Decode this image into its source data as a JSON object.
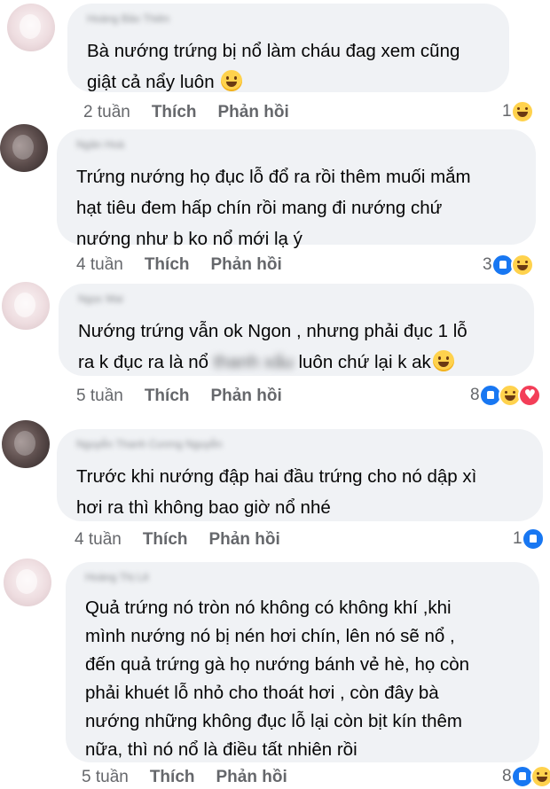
{
  "comments": [
    {
      "author": "Hoàng Bảo Thiên",
      "lines": [
        "Bà nướng trứng bị nổ làm cháu đag xem cũng",
        "giật cả nẩy luôn"
      ],
      "time": "2 tuần",
      "like": "Thích",
      "reply": "Phản hồi",
      "reaction_count": "1",
      "reactions": [
        "haha"
      ]
    },
    {
      "author": "Ngân Hoà",
      "lines": [
        "Trứng nướng họ đục lỗ đổ ra rồi thêm muối mắm",
        "hạt tiêu đem hấp chín rồi mang đi nướng chứ",
        "nướng như b ko nổ mới lạ ý"
      ],
      "time": "4 tuần",
      "like": "Thích",
      "reply": "Phản hồi",
      "reaction_count": "3",
      "reactions": [
        "like",
        "haha"
      ]
    },
    {
      "author": "Ngọc Mai",
      "line1": "Nướng trứng vẫn ok Ngon , nhưng phải đục 1 lỗ",
      "line2_a": "ra k đục ra là nổ",
      "line2_hidden": "thanh xấu",
      "line2_b": "luôn chứ lại k ak",
      "time": "5 tuần",
      "like": "Thích",
      "reply": "Phản hồi",
      "reaction_count": "8",
      "reactions": [
        "like",
        "haha",
        "love"
      ]
    },
    {
      "author": "Nguyễn Thanh Cương Nguyễn",
      "lines": [
        "Trước khi nướng đập hai đầu trứng cho nó dập xì",
        "hơi ra thì không bao giờ nổ nhé"
      ],
      "time": "4 tuần",
      "like": "Thích",
      "reply": "Phản hồi",
      "reaction_count": "1",
      "reactions": [
        "like"
      ]
    },
    {
      "author": "Hoàng Thị Lê",
      "lines": [
        "Quả trứng nó tròn nó không có không khí ,khi",
        "mình nướng nó bị nén hơi chín, lên  nó sẽ nổ ,",
        "đến quả trứng gà họ nướng bánh vẻ hè, họ còn",
        "phải khuét lỗ nhỏ cho thoát hơi , còn đây bà",
        "nướng những không đục lỗ lại còn bịt kín thêm",
        "nữa, thì nó nổ là điều tất nhiên rồi"
      ],
      "time": "5 tuần",
      "like": "Thích",
      "reply": "Phản hồi",
      "reaction_count": "8",
      "reactions": [
        "like",
        "haha"
      ]
    }
  ],
  "icons": {
    "emoji": "grinning-sweat-emoji-icon",
    "like": "like-reaction-icon",
    "haha": "haha-reaction-icon",
    "love": "love-reaction-icon"
  },
  "colors": {
    "bubble": "#f0f2f5",
    "meta_text": "#65676b",
    "like_blue": "#1877f2"
  }
}
